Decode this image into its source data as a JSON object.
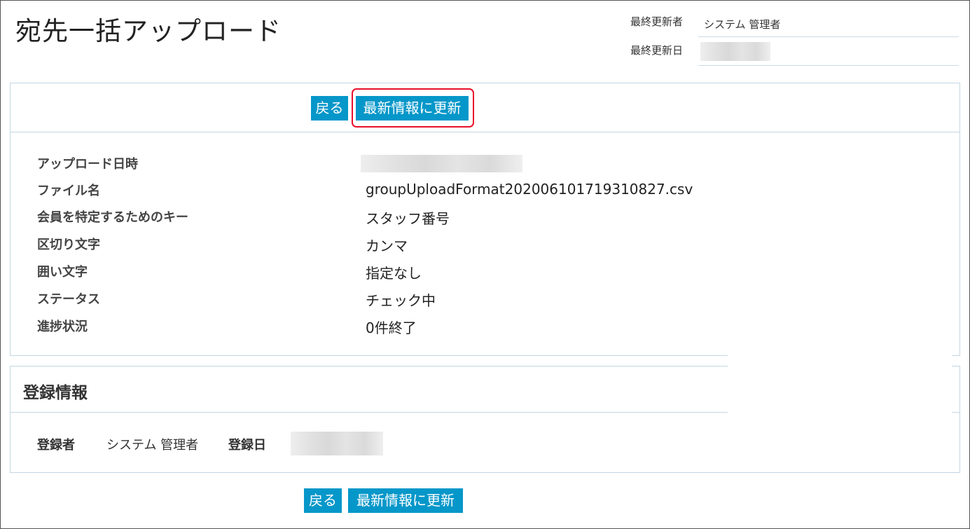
{
  "page": {
    "title": "宛先一括アップロード"
  },
  "meta": {
    "last_updated_by_label": "最終更新者",
    "last_updated_by_value": "システム 管理者",
    "last_updated_date_label": "最終更新日"
  },
  "toolbar": {
    "back_label": "戻る",
    "refresh_label": "最新情報に更新"
  },
  "details": {
    "rows": [
      {
        "label": "アップロード日時",
        "value": ""
      },
      {
        "label": "ファイル名",
        "value": "groupUploadFormat20200610171931082​7.csv"
      },
      {
        "label": "会員を特定するためのキー",
        "value": "スタッフ番号"
      },
      {
        "label": "区切り文字",
        "value": "カンマ"
      },
      {
        "label": "囲い文字",
        "value": "指定なし"
      },
      {
        "label": "ステータス",
        "value": "チェック中"
      },
      {
        "label": "進捗状況",
        "value": "0件終了"
      }
    ]
  },
  "registration": {
    "heading": "登録情報",
    "registrant_label": "登録者",
    "registrant_value": "システム 管理者",
    "registered_date_label": "登録日"
  },
  "colors": {
    "button": "#0597c9",
    "highlight": "#e8102a",
    "border": "#c3d7e3"
  }
}
